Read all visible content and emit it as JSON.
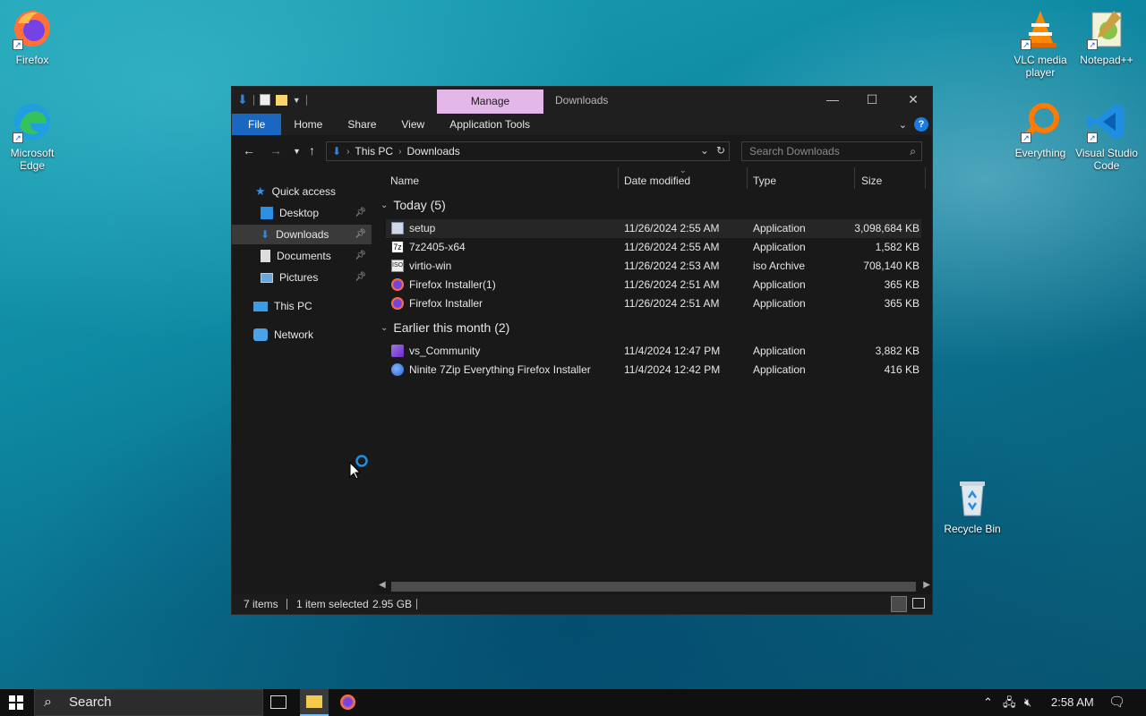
{
  "desktop": {
    "icons": [
      {
        "label": "Firefox"
      },
      {
        "label": "Microsoft Edge"
      },
      {
        "label": "VLC media player"
      },
      {
        "label": "Notepad++"
      },
      {
        "label": "Everything"
      },
      {
        "label": "Visual Studio Code"
      },
      {
        "label": "Recycle Bin"
      }
    ]
  },
  "window": {
    "title": "Downloads",
    "manage_tab": "Manage",
    "ribbon_tabs": [
      "File",
      "Home",
      "Share",
      "View",
      "Application Tools"
    ],
    "address": {
      "segments": [
        "This PC",
        "Downloads"
      ]
    },
    "search_placeholder": "Search Downloads",
    "nav": {
      "quick_access": "Quick access",
      "items": [
        {
          "label": "Desktop",
          "pinned": true
        },
        {
          "label": "Downloads",
          "pinned": true
        },
        {
          "label": "Documents",
          "pinned": true
        },
        {
          "label": "Pictures",
          "pinned": true
        }
      ],
      "this_pc": "This PC",
      "network": "Network"
    },
    "columns": [
      "Name",
      "Date modified",
      "Type",
      "Size"
    ],
    "groups": [
      {
        "label": "Today (5)",
        "files": [
          {
            "name": "setup",
            "date": "11/26/2024 2:55 AM",
            "type": "Application",
            "size": "3,098,684 KB",
            "selected": true
          },
          {
            "name": "7z2405-x64",
            "date": "11/26/2024 2:55 AM",
            "type": "Application",
            "size": "1,582 KB"
          },
          {
            "name": "virtio-win",
            "date": "11/26/2024 2:53 AM",
            "type": "iso Archive",
            "size": "708,140 KB"
          },
          {
            "name": "Firefox Installer(1)",
            "date": "11/26/2024 2:51 AM",
            "type": "Application",
            "size": "365 KB"
          },
          {
            "name": "Firefox Installer",
            "date": "11/26/2024 2:51 AM",
            "type": "Application",
            "size": "365 KB"
          }
        ]
      },
      {
        "label": "Earlier this month (2)",
        "files": [
          {
            "name": "vs_Community",
            "date": "11/4/2024 12:47 PM",
            "type": "Application",
            "size": "3,882 KB"
          },
          {
            "name": "Ninite 7Zip Everything Firefox Installer",
            "date": "11/4/2024 12:42 PM",
            "type": "Application",
            "size": "416 KB"
          }
        ]
      }
    ],
    "status": {
      "count": "7 items",
      "selection": "1 item selected",
      "selection_size": "2.95 GB"
    }
  },
  "taskbar": {
    "search_label": "Search",
    "clock": "2:58 AM"
  },
  "colors": {
    "accent": "#1a67c2",
    "manage_tab": "#e3b8e8",
    "window_bg": "#191919"
  }
}
